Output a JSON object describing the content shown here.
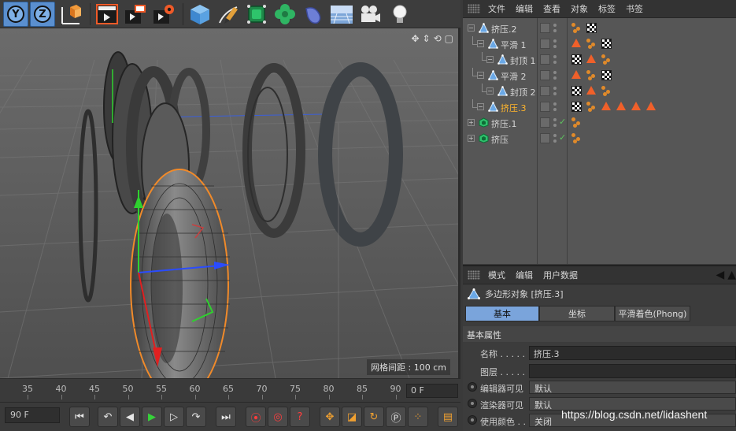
{
  "toolbar": {
    "axis_y": "Y",
    "axis_z": "Z",
    "icons": [
      "axis-y-lock-icon",
      "axis-z-lock-icon",
      "coordinate-system-icon",
      "render-view-icon",
      "render-picture-viewer-icon",
      "render-settings-icon",
      "cube-primitive-icon",
      "pen-spline-icon",
      "subdivision-surface-icon",
      "cloner-icon",
      "deformer-icon",
      "floor-environment-icon",
      "camera-icon",
      "light-icon"
    ]
  },
  "viewport": {
    "grid_label": "网格间距 : 100 cm"
  },
  "timeline": {
    "ticks": [
      "35",
      "40",
      "45",
      "50",
      "55",
      "60",
      "65",
      "70",
      "75",
      "80",
      "85",
      "90"
    ],
    "current_frame": "0 F"
  },
  "transport": {
    "end_frame": "90 F"
  },
  "object_manager": {
    "menu": [
      "文件",
      "编辑",
      "查看",
      "对象",
      "标签",
      "书签"
    ],
    "objects": [
      {
        "name": "挤压.2",
        "depth": 0,
        "selected": false
      },
      {
        "name": "平滑 1",
        "depth": 1,
        "selected": false
      },
      {
        "name": "封顶 1",
        "depth": 2,
        "selected": false
      },
      {
        "name": "平滑 2",
        "depth": 1,
        "selected": false
      },
      {
        "name": "封顶 2",
        "depth": 2,
        "selected": false
      },
      {
        "name": "挤压.3",
        "depth": 1,
        "selected": true
      },
      {
        "name": "挤压.1",
        "depth": 0,
        "selected": false
      },
      {
        "name": "挤压",
        "depth": 0,
        "selected": false
      }
    ]
  },
  "attribute_manager": {
    "menu": [
      "模式",
      "编辑",
      "用户数据"
    ],
    "title": "多边形对象 [挤压.3]",
    "tabs": [
      "基本",
      "坐标",
      "平滑着色(Phong)"
    ],
    "section": "基本属性",
    "props": [
      {
        "label": "名称 . . . . .",
        "value": "挤压.3"
      },
      {
        "label": "图层 . . . . .",
        "value": ""
      },
      {
        "label": "编辑器可见",
        "value": "默认"
      },
      {
        "label": "渲染器可见",
        "value": "默认"
      },
      {
        "label": "使用颜色 . .",
        "value": "关闭"
      }
    ]
  },
  "watermark": "https://blog.csdn.net/lidashent",
  "colors": {
    "selection": "#ffb52c",
    "active_tab": "#7aa4db",
    "tag_orange": "#f0602a"
  }
}
